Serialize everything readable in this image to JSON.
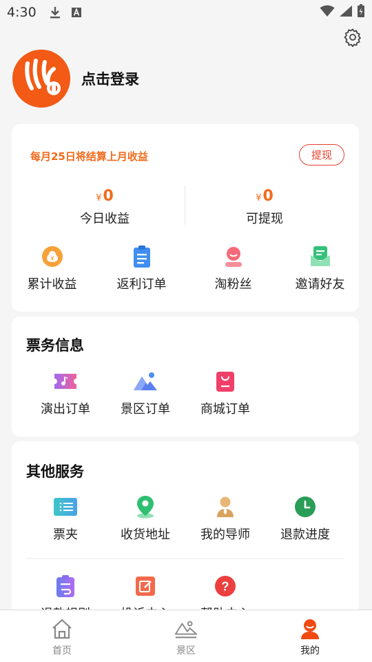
{
  "status_bar": {
    "time": "4:30"
  },
  "profile": {
    "login_text": "点击登录"
  },
  "earnings": {
    "settle_notice": "每月25日将结算上月收益",
    "withdraw_label": "提现",
    "currency_symbol": "¥",
    "today_amount": "0",
    "today_label": "今日收益",
    "withdrawable_amount": "0",
    "withdrawable_label": "可提现",
    "items": [
      {
        "label": "累计收益",
        "icon": "money-bag-icon"
      },
      {
        "label": "返利订单",
        "icon": "clipboard-icon"
      },
      {
        "label": "淘粉丝",
        "icon": "fan-user-icon"
      },
      {
        "label": "邀请好友",
        "icon": "invite-envelope-icon"
      }
    ]
  },
  "tickets": {
    "title": "票务信息",
    "items": [
      {
        "label": "演出订单",
        "icon": "music-ticket-icon"
      },
      {
        "label": "景区订单",
        "icon": "mountain-icon"
      },
      {
        "label": "商城订单",
        "icon": "shopping-bag-icon"
      }
    ]
  },
  "services": {
    "title": "其他服务",
    "row1": [
      {
        "label": "票夹",
        "icon": "ticket-folder-icon"
      },
      {
        "label": "收货地址",
        "icon": "location-pin-icon"
      },
      {
        "label": "我的导师",
        "icon": "mentor-icon"
      },
      {
        "label": "退款进度",
        "icon": "clock-icon"
      }
    ],
    "row2": [
      {
        "label": "退款规则",
        "icon": "refund-rules-icon"
      },
      {
        "label": "投诉中心",
        "icon": "complaint-icon"
      },
      {
        "label": "帮助中心",
        "icon": "help-icon"
      }
    ]
  },
  "tab_bar": {
    "tabs": [
      {
        "label": "首页",
        "icon": "home-icon"
      },
      {
        "label": "景区",
        "icon": "scenic-icon"
      },
      {
        "label": "我的",
        "icon": "profile-icon",
        "active": true
      }
    ]
  },
  "colors": {
    "accent": "#f26a1b",
    "brand": "#f25a16",
    "withdraw_border": "#e8402e"
  }
}
